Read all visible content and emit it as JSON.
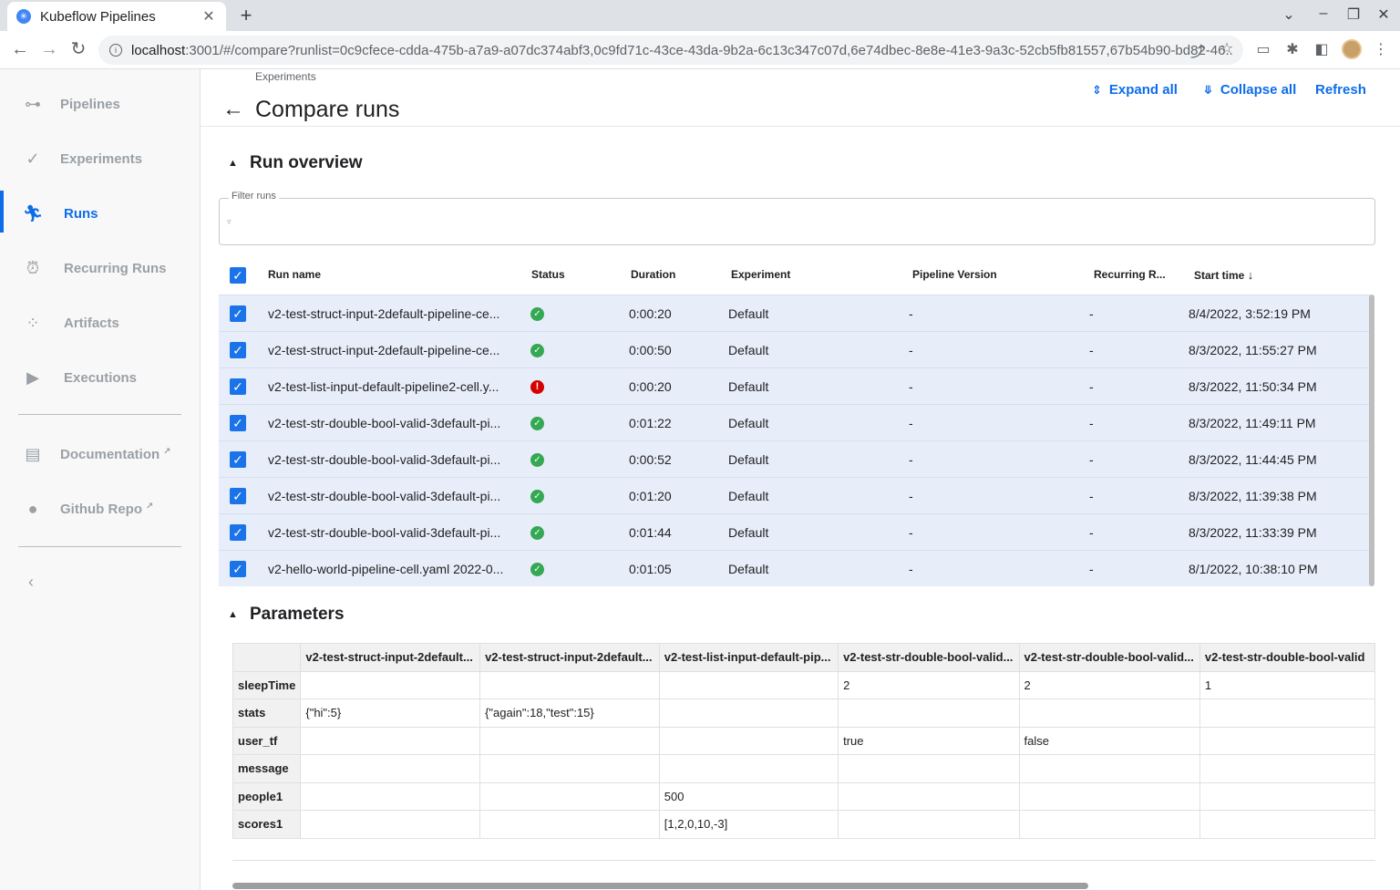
{
  "browser": {
    "tab_title": "Kubeflow Pipelines",
    "url_host": "localhost",
    "url_path": ":3001/#/compare?runlist=0c9cfece-cdda-475b-a7a9-a07dc374abf3,0c9fd71c-43ce-43da-9b2a-6c13c347c07d,6e74dbec-8e8e-41e3-9a3c-52cb5fb81557,67b54b90-bd82-46..."
  },
  "sidebar": {
    "items": [
      {
        "label": "Pipelines",
        "icon": "pipelines-icon"
      },
      {
        "label": "Experiments",
        "icon": "experiments-icon"
      },
      {
        "label": "Runs",
        "icon": "runs-icon"
      },
      {
        "label": "Recurring Runs",
        "icon": "alarm-icon"
      },
      {
        "label": "Artifacts",
        "icon": "artifacts-icon"
      },
      {
        "label": "Executions",
        "icon": "play-icon"
      }
    ],
    "links": [
      {
        "label": "Documentation",
        "icon": "document-icon"
      },
      {
        "label": "Github Repo",
        "icon": "github-icon"
      }
    ],
    "active": "Runs"
  },
  "header": {
    "breadcrumb": "Experiments",
    "title": "Compare runs",
    "expand_all": "Expand all",
    "collapse_all": "Collapse all",
    "refresh": "Refresh"
  },
  "run_overview": {
    "title": "Run overview",
    "filter_label": "Filter runs",
    "columns": [
      "Run name",
      "Status",
      "Duration",
      "Experiment",
      "Pipeline Version",
      "Recurring R...",
      "Start time"
    ],
    "rows": [
      {
        "name": "v2-test-struct-input-2default-pipeline-ce...",
        "status": "ok",
        "duration": "0:00:20",
        "experiment": "Default",
        "pipeline_version": "-",
        "recurring": "-",
        "start": "8/4/2022, 3:52:19 PM"
      },
      {
        "name": "v2-test-struct-input-2default-pipeline-ce...",
        "status": "ok",
        "duration": "0:00:50",
        "experiment": "Default",
        "pipeline_version": "-",
        "recurring": "-",
        "start": "8/3/2022, 11:55:27 PM"
      },
      {
        "name": "v2-test-list-input-default-pipeline2-cell.y...",
        "status": "error",
        "duration": "0:00:20",
        "experiment": "Default",
        "pipeline_version": "-",
        "recurring": "-",
        "start": "8/3/2022, 11:50:34 PM"
      },
      {
        "name": "v2-test-str-double-bool-valid-3default-pi...",
        "status": "ok",
        "duration": "0:01:22",
        "experiment": "Default",
        "pipeline_version": "-",
        "recurring": "-",
        "start": "8/3/2022, 11:49:11 PM"
      },
      {
        "name": "v2-test-str-double-bool-valid-3default-pi...",
        "status": "ok",
        "duration": "0:00:52",
        "experiment": "Default",
        "pipeline_version": "-",
        "recurring": "-",
        "start": "8/3/2022, 11:44:45 PM"
      },
      {
        "name": "v2-test-str-double-bool-valid-3default-pi...",
        "status": "ok",
        "duration": "0:01:20",
        "experiment": "Default",
        "pipeline_version": "-",
        "recurring": "-",
        "start": "8/3/2022, 11:39:38 PM"
      },
      {
        "name": "v2-test-str-double-bool-valid-3default-pi...",
        "status": "ok",
        "duration": "0:01:44",
        "experiment": "Default",
        "pipeline_version": "-",
        "recurring": "-",
        "start": "8/3/2022, 11:33:39 PM"
      },
      {
        "name": "v2-hello-world-pipeline-cell.yaml 2022-0...",
        "status": "ok",
        "duration": "0:01:05",
        "experiment": "Default",
        "pipeline_version": "-",
        "recurring": "-",
        "start": "8/1/2022, 10:38:10 PM"
      }
    ]
  },
  "parameters": {
    "title": "Parameters",
    "columns": [
      "v2-test-struct-input-2default...",
      "v2-test-struct-input-2default...",
      "v2-test-list-input-default-pip...",
      "v2-test-str-double-bool-valid...",
      "v2-test-str-double-bool-valid...",
      "v2-test-str-double-bool-valid"
    ],
    "rows": [
      {
        "name": "sleepTime",
        "values": [
          "",
          "",
          "",
          "2",
          "2",
          "1"
        ]
      },
      {
        "name": "stats",
        "values": [
          "{\"hi\":5}",
          "{\"again\":18,\"test\":15}",
          "",
          "",
          "",
          ""
        ]
      },
      {
        "name": "user_tf",
        "values": [
          "",
          "",
          "",
          "true",
          "false",
          ""
        ]
      },
      {
        "name": "message",
        "values": [
          "",
          "",
          "",
          "",
          "",
          ""
        ]
      },
      {
        "name": "people1",
        "values": [
          "",
          "",
          "500",
          "",
          "",
          ""
        ]
      },
      {
        "name": "scores1",
        "values": [
          "",
          "",
          "[1,2,0,10,-3]",
          "",
          "",
          ""
        ]
      }
    ]
  }
}
